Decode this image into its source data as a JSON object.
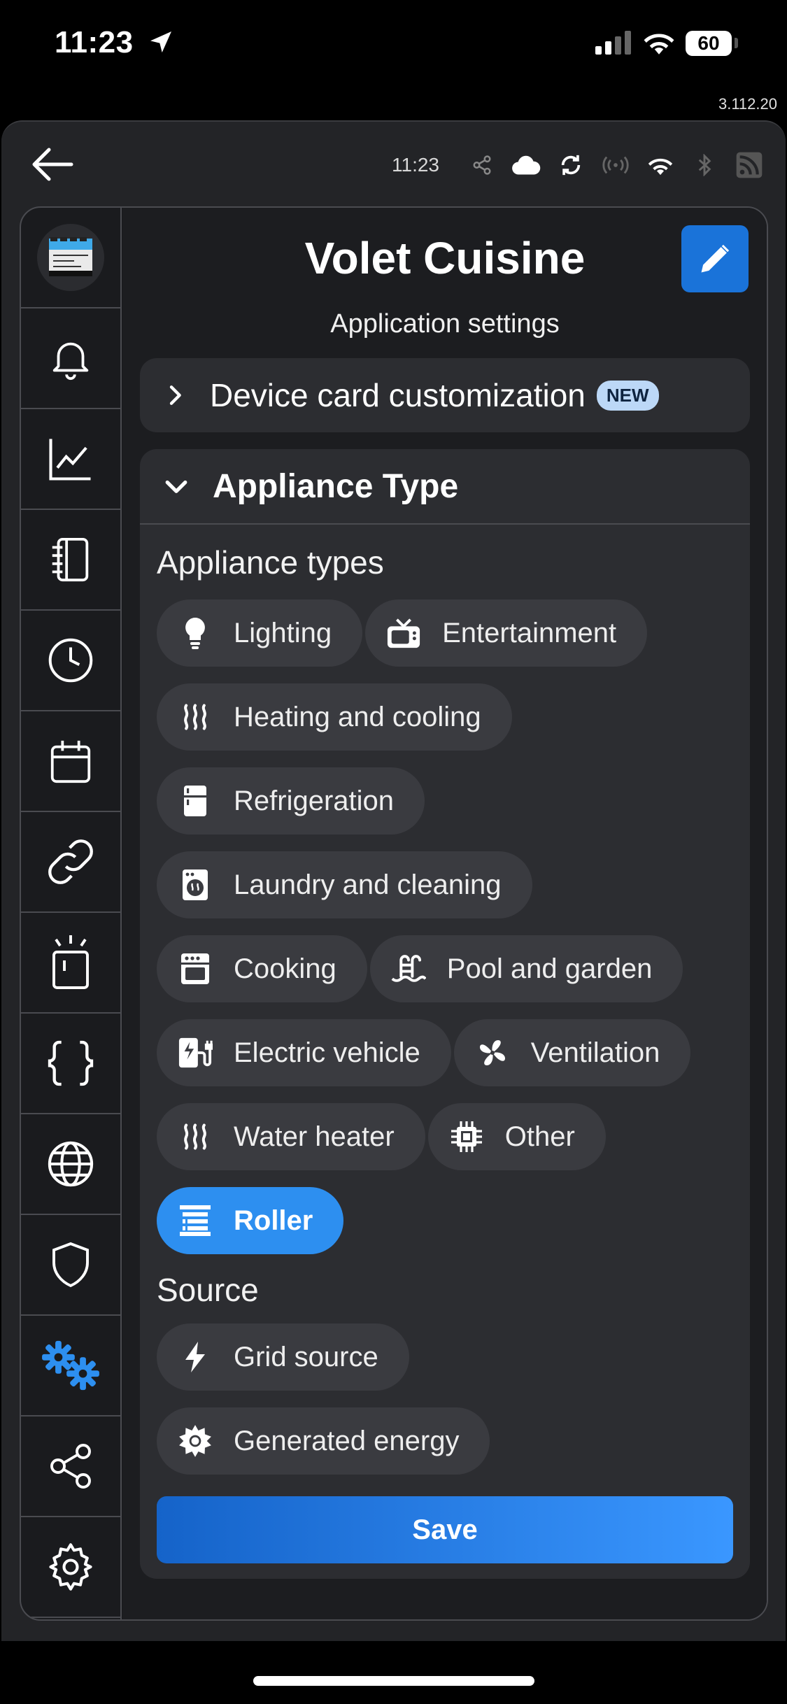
{
  "status_bar": {
    "time": "11:23",
    "battery": "60"
  },
  "version": "3.112.20",
  "toolbar": {
    "clock": "11:23",
    "icons": [
      "share-icon",
      "cloud-icon",
      "sync-icon",
      "broadcast-icon",
      "wifi-icon",
      "bluetooth-icon",
      "rss-icon"
    ]
  },
  "sidebar": {
    "items": [
      "device-avatar",
      "notifications",
      "charts",
      "logs",
      "schedule",
      "calendar",
      "links",
      "actions",
      "scripts",
      "internet",
      "security",
      "app-settings",
      "sharing",
      "settings"
    ],
    "active": "app-settings",
    "accent": "#2d8ff0"
  },
  "header": {
    "title": "Volet Cuisine",
    "subtitle": "Application settings"
  },
  "device_card": {
    "label": "Device card customization",
    "badge": "NEW"
  },
  "appliance_section": {
    "label": "Appliance Type",
    "types_title": "Appliance types",
    "types": [
      {
        "label": "Lighting",
        "icon": "bulb-icon"
      },
      {
        "label": "Entertainment",
        "icon": "tv-icon"
      },
      {
        "label": "Heating and cooling",
        "icon": "heat-icon"
      },
      {
        "label": "Refrigeration",
        "icon": "fridge-icon"
      },
      {
        "label": "Laundry and cleaning",
        "icon": "washer-icon"
      },
      {
        "label": "Cooking",
        "icon": "oven-icon"
      },
      {
        "label": "Pool and garden",
        "icon": "pool-icon"
      },
      {
        "label": "Electric vehicle",
        "icon": "ev-charger-icon"
      },
      {
        "label": "Ventilation",
        "icon": "fan-icon"
      },
      {
        "label": "Water heater",
        "icon": "heat-icon"
      },
      {
        "label": "Other",
        "icon": "chip-icon"
      },
      {
        "label": "Roller",
        "icon": "blinds-icon",
        "selected": true
      }
    ],
    "source_title": "Source",
    "sources": [
      {
        "label": "Grid source",
        "icon": "bolt-icon"
      },
      {
        "label": "Generated energy",
        "icon": "sun-icon"
      }
    ],
    "save_label": "Save"
  },
  "colors": {
    "primary": "#2d8ff0",
    "edit_button": "#1a73d9",
    "chip_bg": "#3a3b40",
    "card_bg": "#2c2d31"
  }
}
